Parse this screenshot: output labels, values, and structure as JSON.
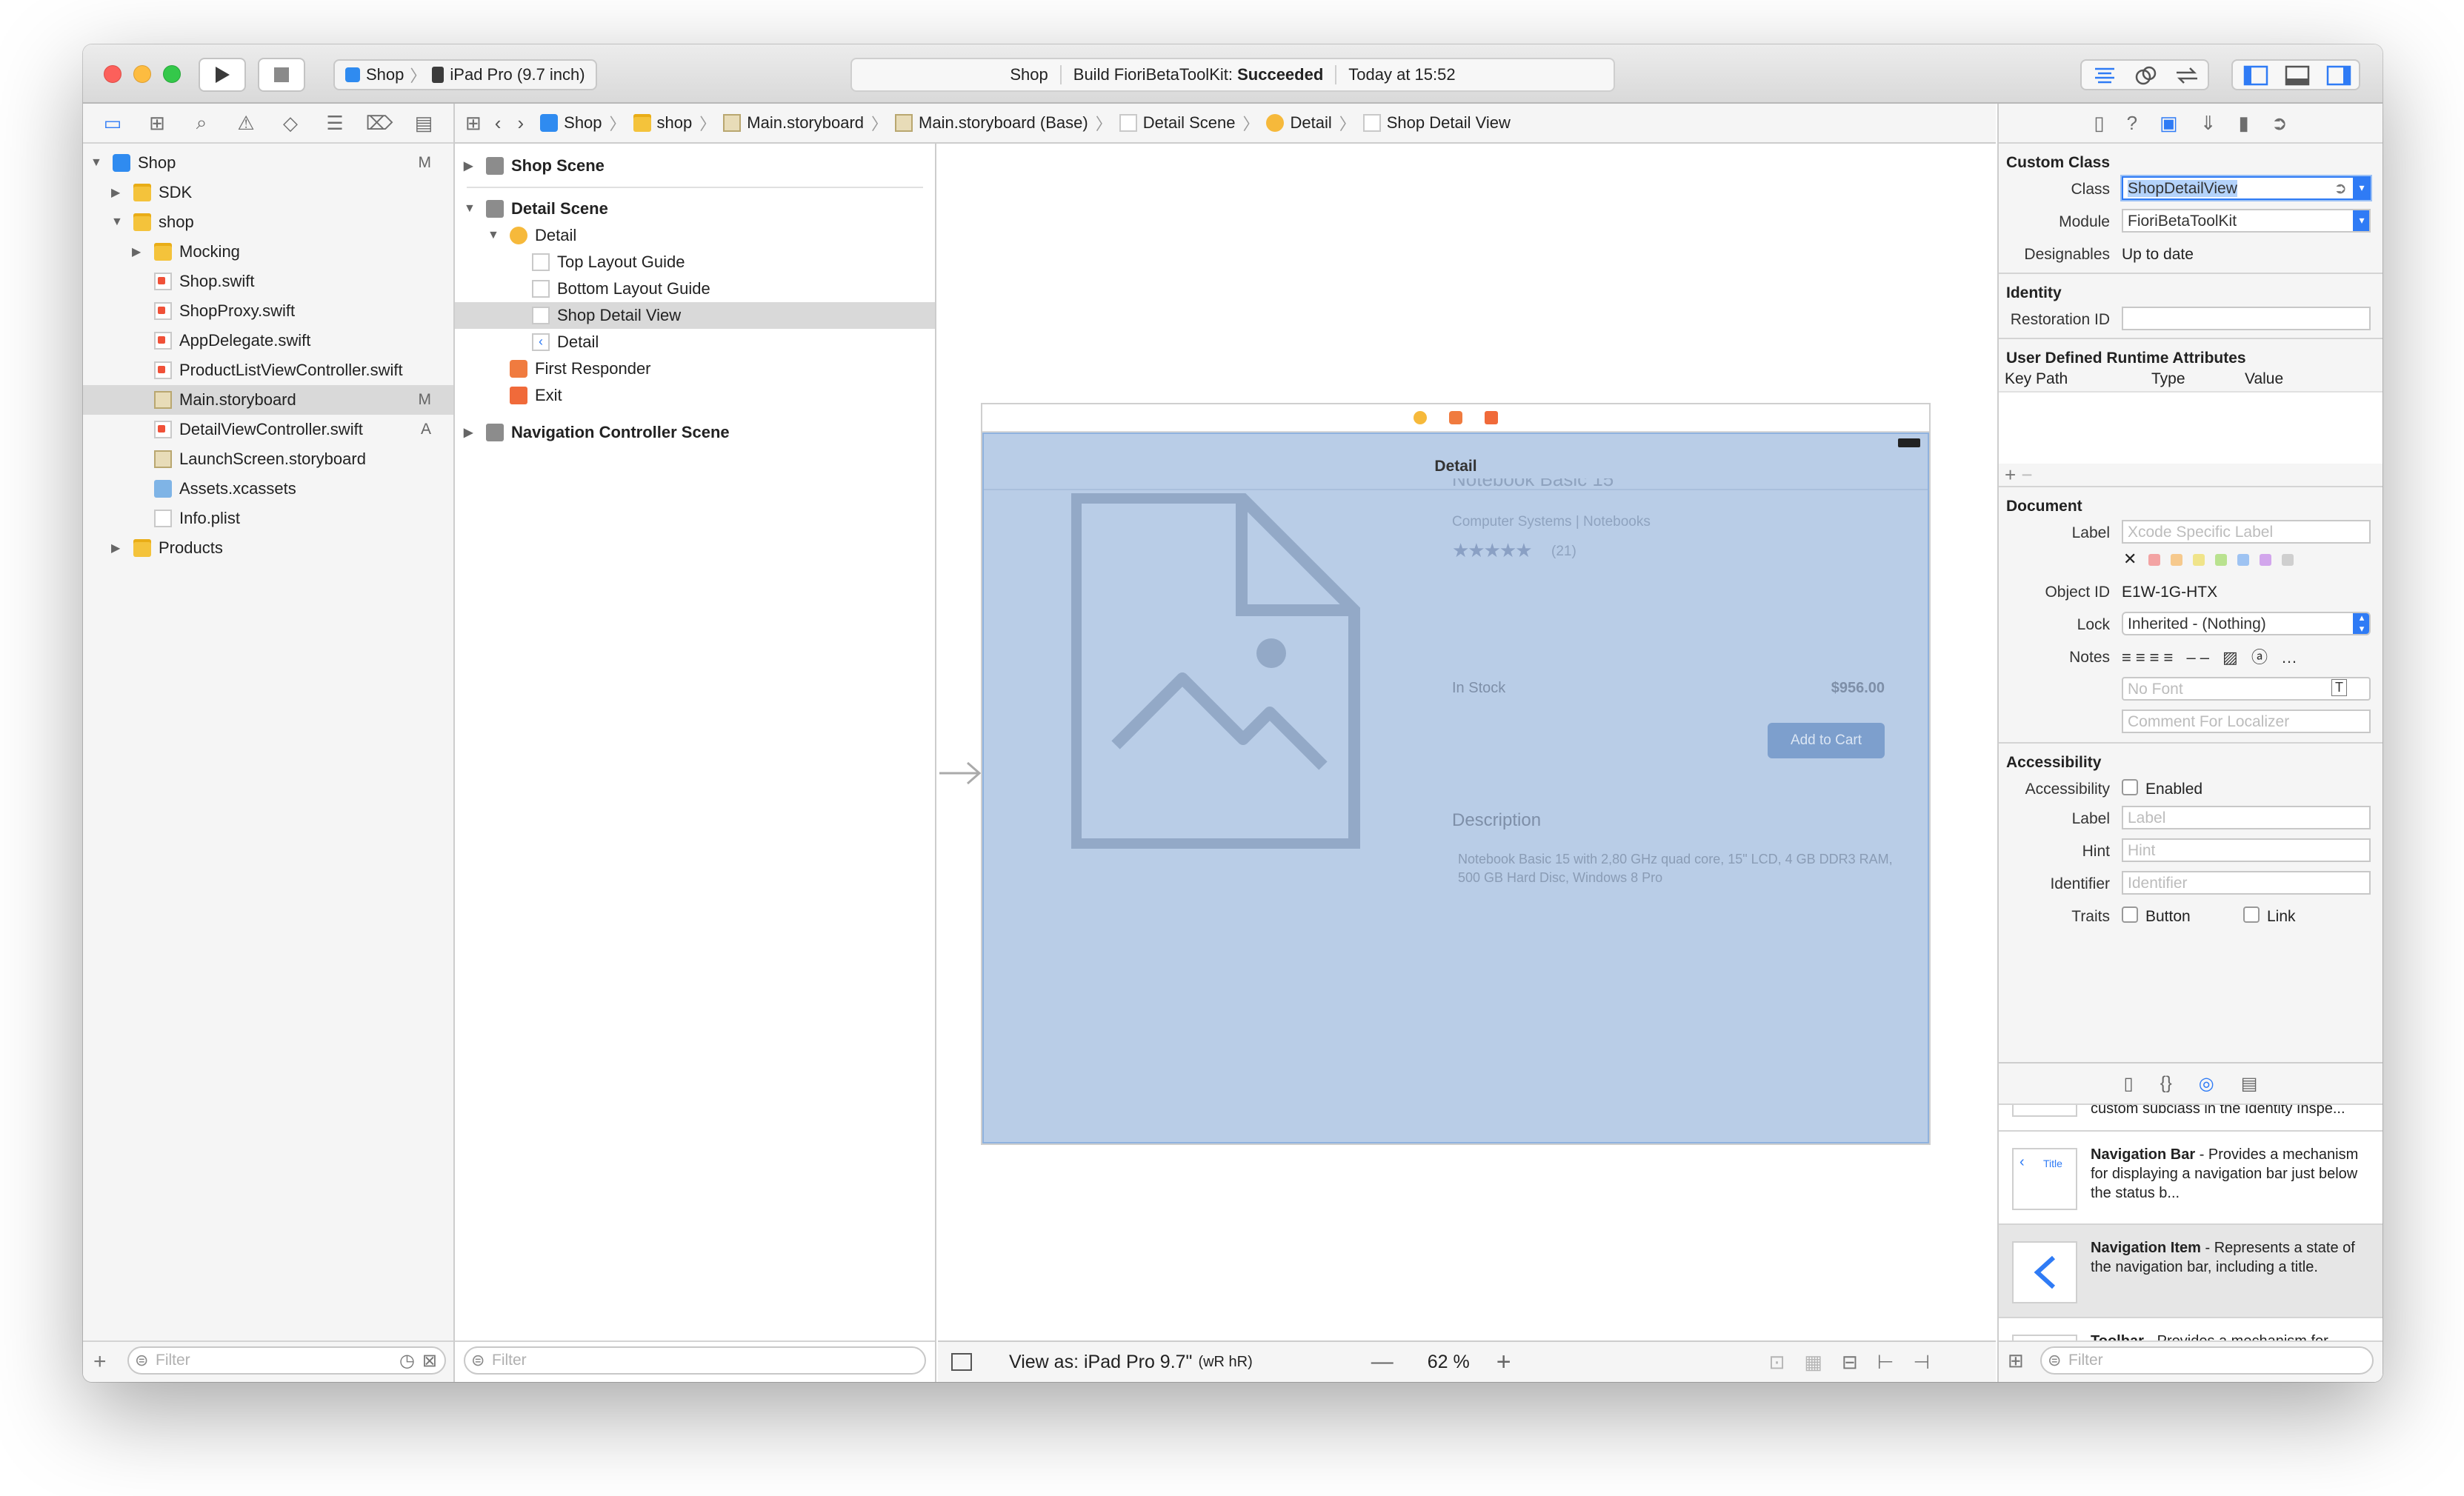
{
  "toolbar": {
    "scheme": "Shop",
    "device": "iPad Pro (9.7 inch)",
    "activity_target": "Shop",
    "activity_prefix": "Build FioriBetaToolKit:",
    "activity_status": "Succeeded",
    "activity_time": "Today at 15:52"
  },
  "navigator": {
    "items": [
      {
        "label": "Shop",
        "badge": "M"
      },
      {
        "label": "SDK",
        "badge": ""
      },
      {
        "label": "shop",
        "badge": ""
      },
      {
        "label": "Mocking",
        "badge": ""
      },
      {
        "label": "Shop.swift",
        "badge": ""
      },
      {
        "label": "ShopProxy.swift",
        "badge": ""
      },
      {
        "label": "AppDelegate.swift",
        "badge": ""
      },
      {
        "label": "ProductListViewController.swift",
        "badge": ""
      },
      {
        "label": "Main.storyboard",
        "badge": "M"
      },
      {
        "label": "DetailViewController.swift",
        "badge": "A"
      },
      {
        "label": "LaunchScreen.storyboard",
        "badge": ""
      },
      {
        "label": "Assets.xcassets",
        "badge": ""
      },
      {
        "label": "Info.plist",
        "badge": ""
      },
      {
        "label": "Products",
        "badge": ""
      }
    ],
    "filter_placeholder": "Filter"
  },
  "jumpbar": [
    "Shop",
    "shop",
    "Main.storyboard",
    "Main.storyboard (Base)",
    "Detail Scene",
    "Detail",
    "Shop Detail View"
  ],
  "outline": {
    "items": [
      "Shop Scene",
      "Detail Scene",
      "Detail",
      "Top Layout Guide",
      "Bottom Layout Guide",
      "Shop Detail View",
      "Detail",
      "First Responder",
      "Exit",
      "Navigation Controller Scene"
    ],
    "filter_placeholder": "Filter"
  },
  "canvas": {
    "nav_title": "Detail",
    "product_title": "Notebook Basic 15",
    "category": "Computer Systems | Notebooks",
    "rating": 4.5,
    "reviews": "(21)",
    "stock": "In Stock",
    "price": "$956.00",
    "cart_button": "Add to Cart",
    "description_title": "Description",
    "description": "Notebook Basic 15 with 2,80 GHz quad core, 15\" LCD, 4 GB DDR3 RAM, 500 GB Hard Disc, Windows 8 Pro",
    "view_as": "View as: iPad Pro 9.7\"",
    "size_class": "(wR hR)",
    "zoom": "62 %"
  },
  "inspector": {
    "custom_class_title": "Custom Class",
    "class_label": "Class",
    "class_value": "ShopDetailView",
    "module_label": "Module",
    "module_value": "FioriBetaToolKit",
    "designables_label": "Designables",
    "designables_value": "Up to date",
    "identity_title": "Identity",
    "restoration_label": "Restoration ID",
    "runtime_title": "User Defined Runtime Attributes",
    "col_keypath": "Key Path",
    "col_type": "Type",
    "col_value": "Value",
    "document_title": "Document",
    "label_label": "Label",
    "label_placeholder": "Xcode Specific Label",
    "objectid_label": "Object ID",
    "objectid_value": "E1W-1G-HTX",
    "lock_label": "Lock",
    "lock_value": "Inherited - (Nothing)",
    "notes_label": "Notes",
    "font_placeholder": "No Font",
    "comment_placeholder": "Comment For Localizer",
    "accessibility_title": "Accessibility",
    "accessibility_label": "Accessibility",
    "enabled_label": "Enabled",
    "acc_label_label": "Label",
    "acc_label_placeholder": "Label",
    "hint_label": "Hint",
    "hint_placeholder": "Hint",
    "identifier_label": "Identifier",
    "identifier_placeholder": "Identifier",
    "traits_label": "Traits",
    "trait_button": "Button",
    "trait_link": "Link",
    "swatch_colors": [
      "#f3a3a3",
      "#f6c98d",
      "#f0e48a",
      "#b9e28f",
      "#9ec3f2",
      "#d2a6ec",
      "#cfcfcf"
    ]
  },
  "library": {
    "items": [
      {
        "name": "",
        "desc": "custom subclass in the Identity Inspe..."
      },
      {
        "name": "Navigation Bar",
        "desc": " - Provides a mechanism for displaying a navigation bar just below the status b..."
      },
      {
        "name": "Navigation Item",
        "desc": " - Represents a state of the navigation bar, including a title."
      },
      {
        "name": "Toolbar",
        "desc": " - Provides a mechanism for displaying a toolbar at the bottom of"
      }
    ],
    "thumb_title": "Title",
    "filter_placeholder": "Filter"
  },
  "colors": {
    "accent": "#2f7bf5",
    "selection_overlay": "#b9cde7",
    "button_blue": "#4a7db7"
  }
}
